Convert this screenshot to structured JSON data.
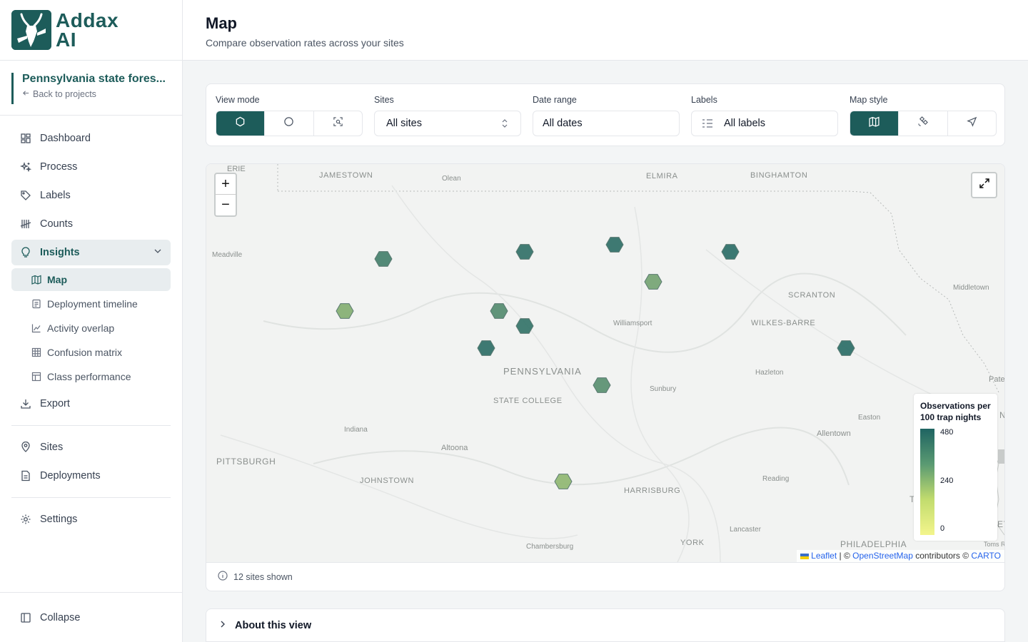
{
  "brand": {
    "name_line1": "Addax",
    "name_line2": "AI"
  },
  "project": {
    "name": "Pennsylvania state fores...",
    "back_label": "Back to projects"
  },
  "nav": {
    "dashboard": "Dashboard",
    "process": "Process",
    "labels": "Labels",
    "counts": "Counts",
    "insights": "Insights",
    "insights_sub": {
      "map": "Map",
      "deployment_timeline": "Deployment timeline",
      "activity_overlap": "Activity overlap",
      "confusion_matrix": "Confusion matrix",
      "class_performance": "Class performance"
    },
    "export": "Export",
    "sites": "Sites",
    "deployments": "Deployments",
    "settings": "Settings",
    "collapse": "Collapse"
  },
  "header": {
    "title": "Map",
    "subtitle": "Compare observation rates across your sites"
  },
  "filters": {
    "view_mode": {
      "label": "View mode",
      "options": [
        "hexagon-icon",
        "circle-icon",
        "scan-icon"
      ],
      "selected": 0
    },
    "sites": {
      "label": "Sites",
      "value": "All sites"
    },
    "date_range": {
      "label": "Date range",
      "value": "All dates"
    },
    "labels": {
      "label": "Labels",
      "value": "All labels"
    },
    "map_style": {
      "label": "Map style",
      "options": [
        "map-icon",
        "satellite-icon",
        "navigation-icon"
      ],
      "selected": 0
    }
  },
  "map": {
    "labels": {
      "erie": "ERIE",
      "jamestown": "JAMESTOWN",
      "olean": "Olean",
      "elmira": "ELMIRA",
      "binghamton": "BINGHAMTON",
      "meadville": "Meadville",
      "middletown": "Middletown",
      "scranton": "SCRANTON",
      "williamsport": "Williamsport",
      "wilkes_barre": "WILKES-BARRE",
      "pennsylvania": "PENNSYLVANIA",
      "hazleton": "Hazleton",
      "pate": "Pate",
      "sunbury": "Sunbury",
      "state_college": "STATE COLLEGE",
      "easton": "Easton",
      "n": "N",
      "indiana": "Indiana",
      "allentown": "Allentown",
      "altoona": "Altoona",
      "pittsburgh": "PITTSBURGH",
      "johnstown": "JOHNSTOWN",
      "reading": "Reading",
      "harrisburg": "HARRISBURG",
      "t": "T",
      "ey": "EY",
      "lancaster": "Lancaster",
      "chambersburg": "Chambersburg",
      "york": "YORK",
      "philadelphia": "PHILADELPHIA",
      "toms": "Toms R"
    },
    "zoom_in": "+",
    "zoom_out": "−",
    "legend": {
      "title": "Observations per 100 trap nights",
      "max": "480",
      "mid": "240",
      "min": "0"
    },
    "attribution": {
      "leaflet": "Leaflet",
      "sep": " | © ",
      "osm": "OpenStreetMap",
      "contrib": " contributors © ",
      "carto": "CARTO"
    },
    "sites": [
      {
        "rate": 360
      },
      {
        "rate": 430
      },
      {
        "rate": 440
      },
      {
        "rate": 450
      },
      {
        "rate": 160
      },
      {
        "rate": 300
      },
      {
        "rate": 420
      },
      {
        "rate": 200
      },
      {
        "rate": 440
      },
      {
        "rate": 280
      },
      {
        "rate": 130
      },
      {
        "rate": 450
      }
    ]
  },
  "footer": {
    "sites_shown": "12 sites shown"
  },
  "about": {
    "label": "About this view"
  },
  "colors": {
    "accent": "#1d5c5a",
    "legend_high": "#1f6462",
    "legend_low": "#f3f58c"
  }
}
